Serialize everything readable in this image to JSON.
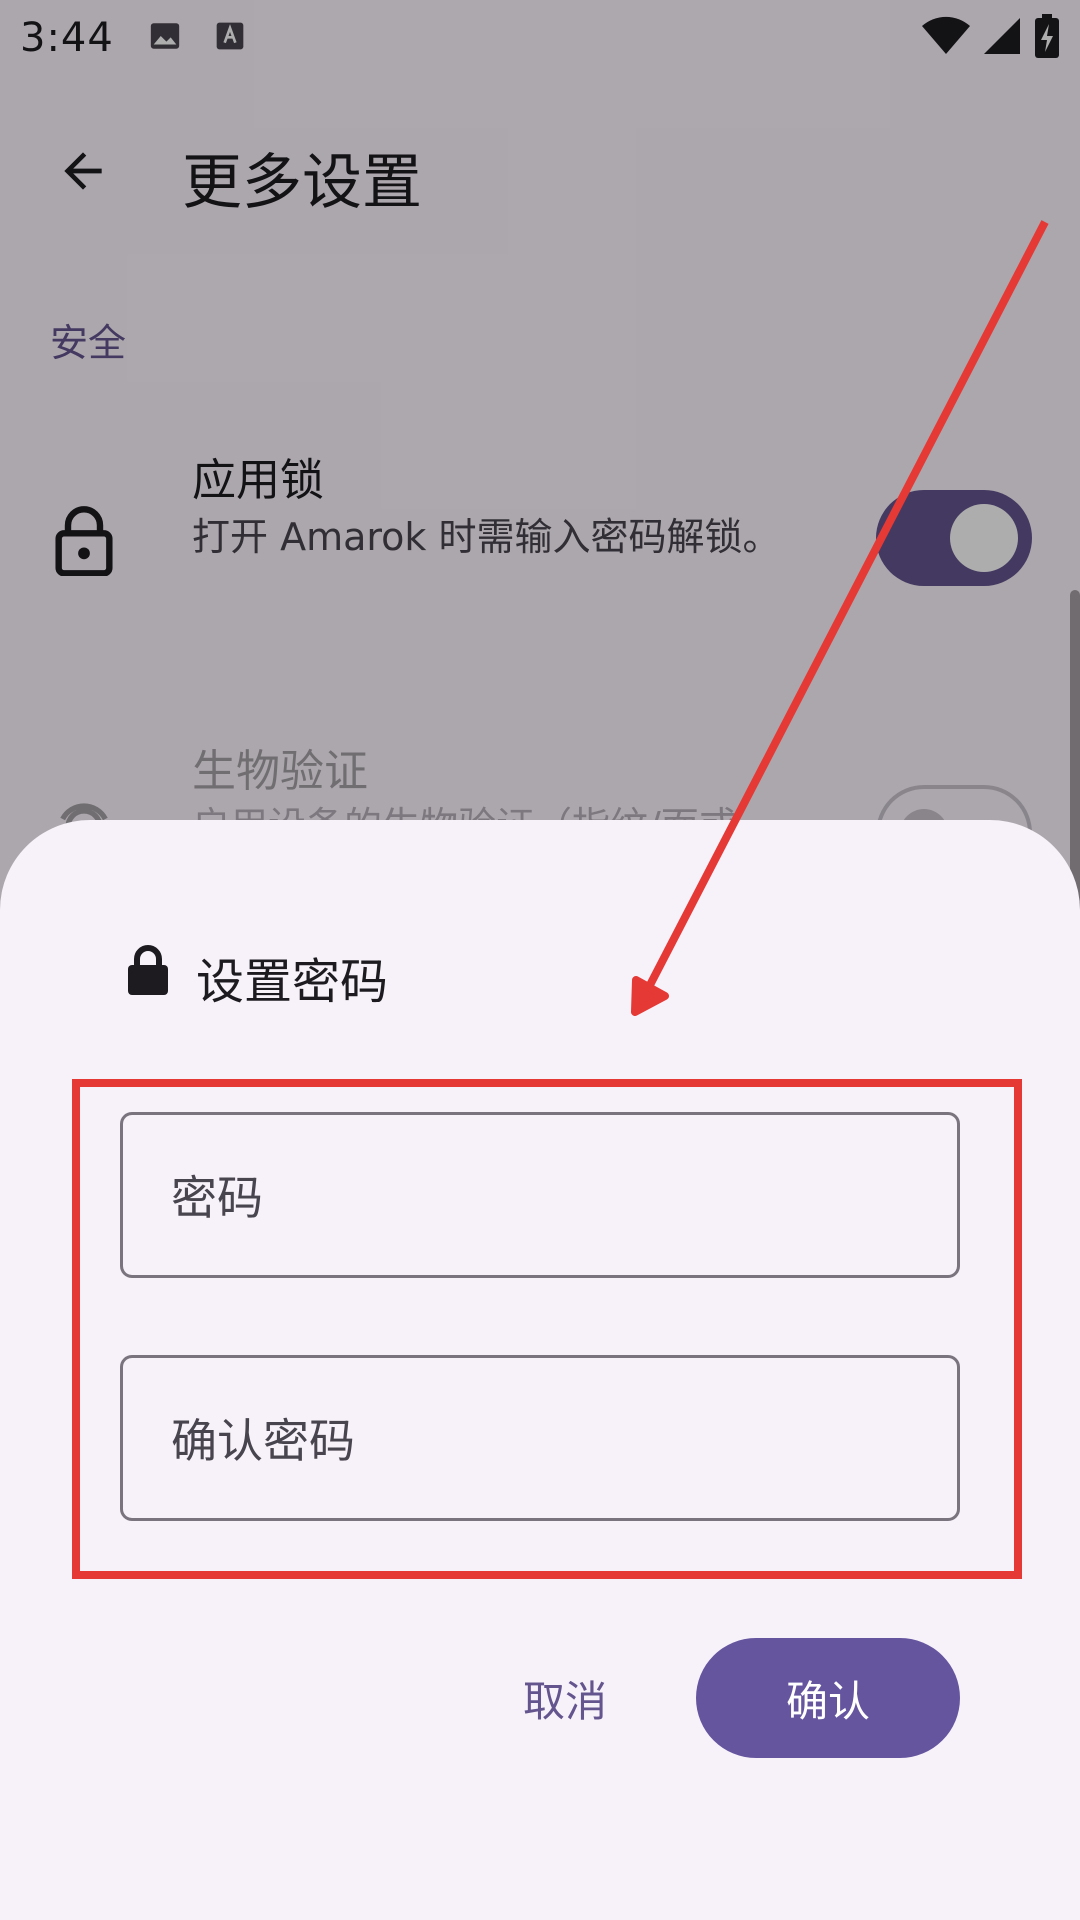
{
  "status_bar": {
    "time": "3:44",
    "icons": [
      "image-icon",
      "text-icon",
      "wifi-icon",
      "signal-icon",
      "battery-charging-icon"
    ]
  },
  "top_bar": {
    "back_icon": "arrow-back-icon",
    "title": "更多设置"
  },
  "settings": {
    "section_title": "安全",
    "items": [
      {
        "icon": "lock-icon",
        "title": "应用锁",
        "description": "打开 Amarok 时需输入密码解锁。",
        "enabled": true
      },
      {
        "icon": "fingerprint-icon",
        "title": "生物验证",
        "description": "启用设备的生物验证（指纹/面或",
        "enabled": false
      }
    ]
  },
  "dialog": {
    "icon": "lock-icon",
    "title": "设置密码",
    "password_placeholder": "密码",
    "confirm_password_placeholder": "确认密码",
    "cancel_label": "取消",
    "confirm_label": "确认"
  },
  "colors": {
    "primary": "#65558f",
    "annotation": "#e53935",
    "sheet_background": "#f7f2fa"
  }
}
